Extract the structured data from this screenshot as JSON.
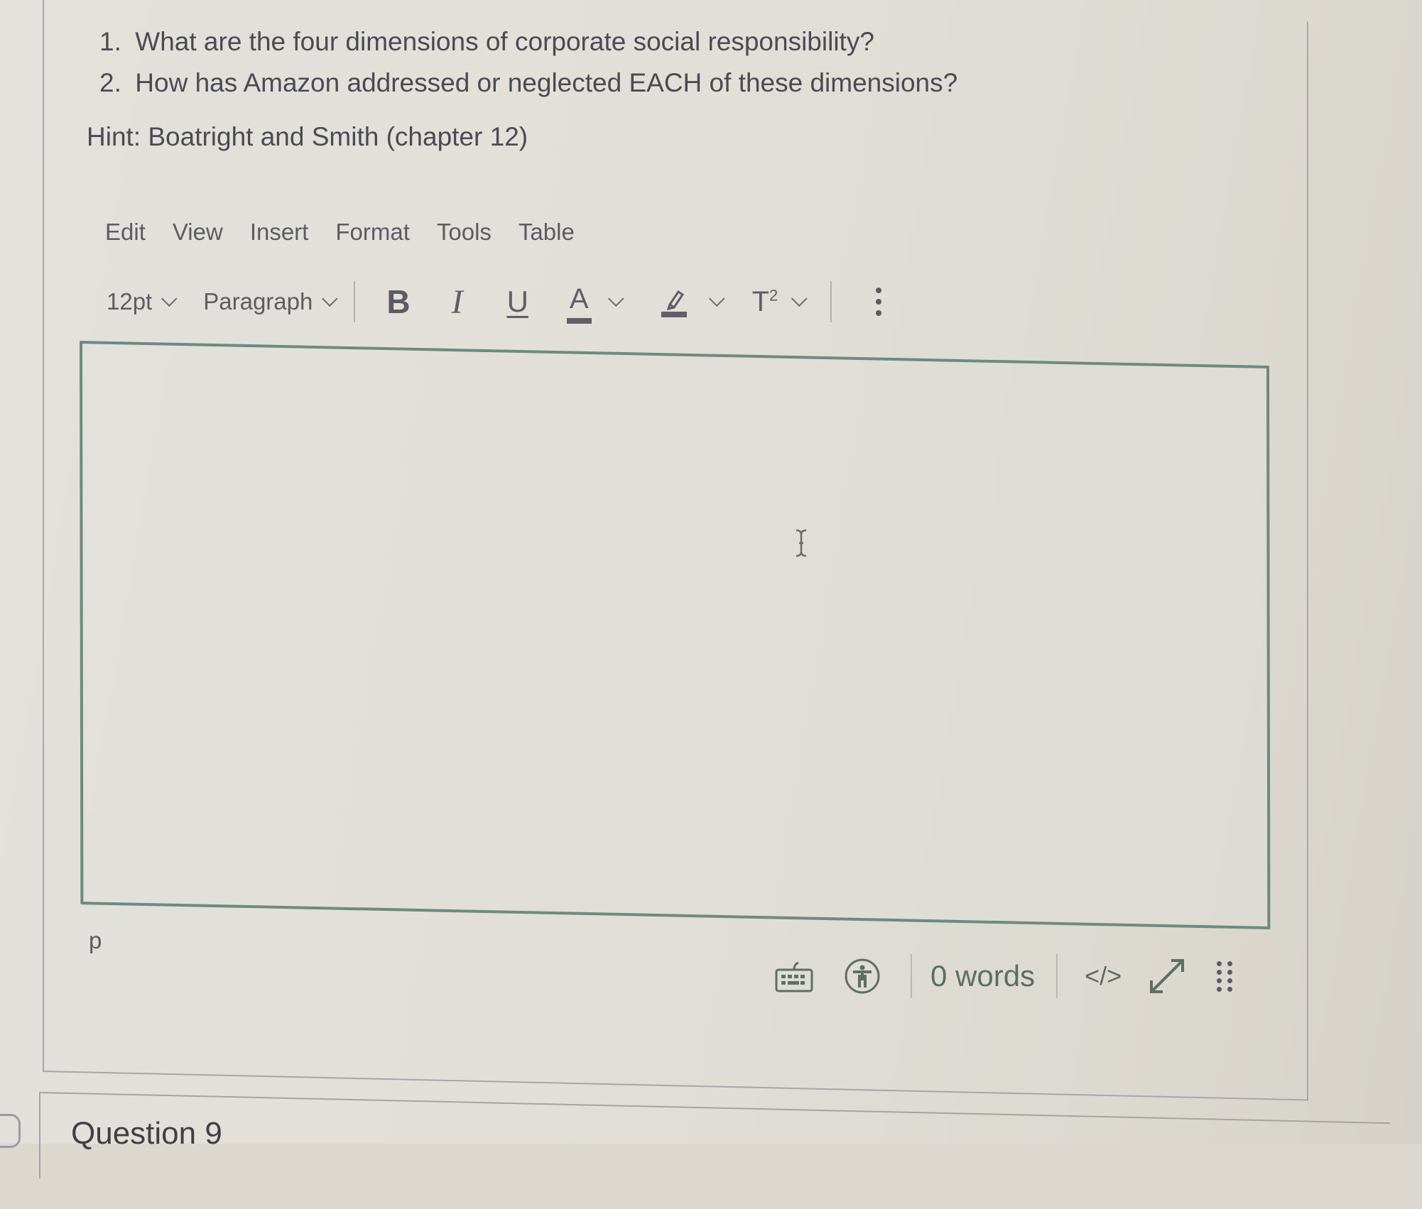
{
  "question": {
    "items": [
      {
        "number": "1.",
        "text": "What are the four dimensions of corporate social responsibility?"
      },
      {
        "number": "2.",
        "text": "How has Amazon addressed or neglected EACH of these dimensions?"
      }
    ],
    "hint": "Hint: Boatright and Smith (chapter 12)"
  },
  "editor": {
    "menu": [
      "Edit",
      "View",
      "Insert",
      "Format",
      "Tools",
      "Table"
    ],
    "toolbar": {
      "font_size": "12pt",
      "block_format": "Paragraph",
      "bold": "B",
      "italic": "I",
      "underline": "U",
      "text_color": "A",
      "superscript_base": "T",
      "superscript_exp": "2",
      "more_icon": "kebab-vertical"
    },
    "content": "",
    "status": {
      "path": "p",
      "word_count": "0 words",
      "html_toggle": "</>",
      "keyboard_icon": "keyboard-icon",
      "accessibility_icon": "accessibility-icon",
      "fullscreen_icon": "expand-diagonal-icon",
      "resize_icon": "drag-grip-icon"
    },
    "border_color": "#6c8a80"
  },
  "next_question": {
    "title": "Question 9"
  }
}
